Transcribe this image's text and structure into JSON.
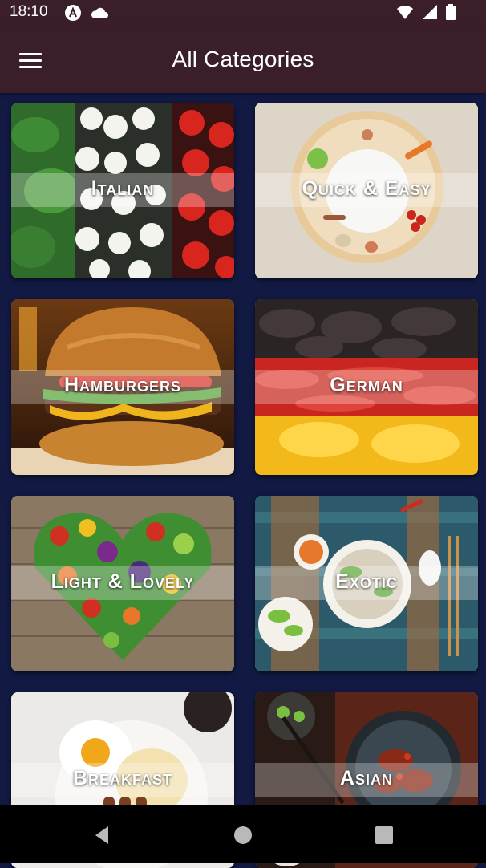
{
  "status": {
    "time": "18:10",
    "icons": [
      "maps-a-icon",
      "cloud-icon",
      "wifi-icon",
      "signal-icon",
      "battery-icon"
    ]
  },
  "appbar": {
    "title": "All Categories",
    "menu_icon": "menu-icon"
  },
  "categories": [
    {
      "label": "Italian"
    },
    {
      "label": "Quick & Easy"
    },
    {
      "label": "Hamburgers"
    },
    {
      "label": "German"
    },
    {
      "label": "Light & Lovely"
    },
    {
      "label": "Exotic"
    },
    {
      "label": "Breakfast"
    },
    {
      "label": "Asian"
    }
  ],
  "nav": {
    "icons": [
      "back-icon",
      "home-icon",
      "recents-icon"
    ]
  },
  "colors": {
    "appbar": "#3a1f2b",
    "background": "#121a43"
  }
}
